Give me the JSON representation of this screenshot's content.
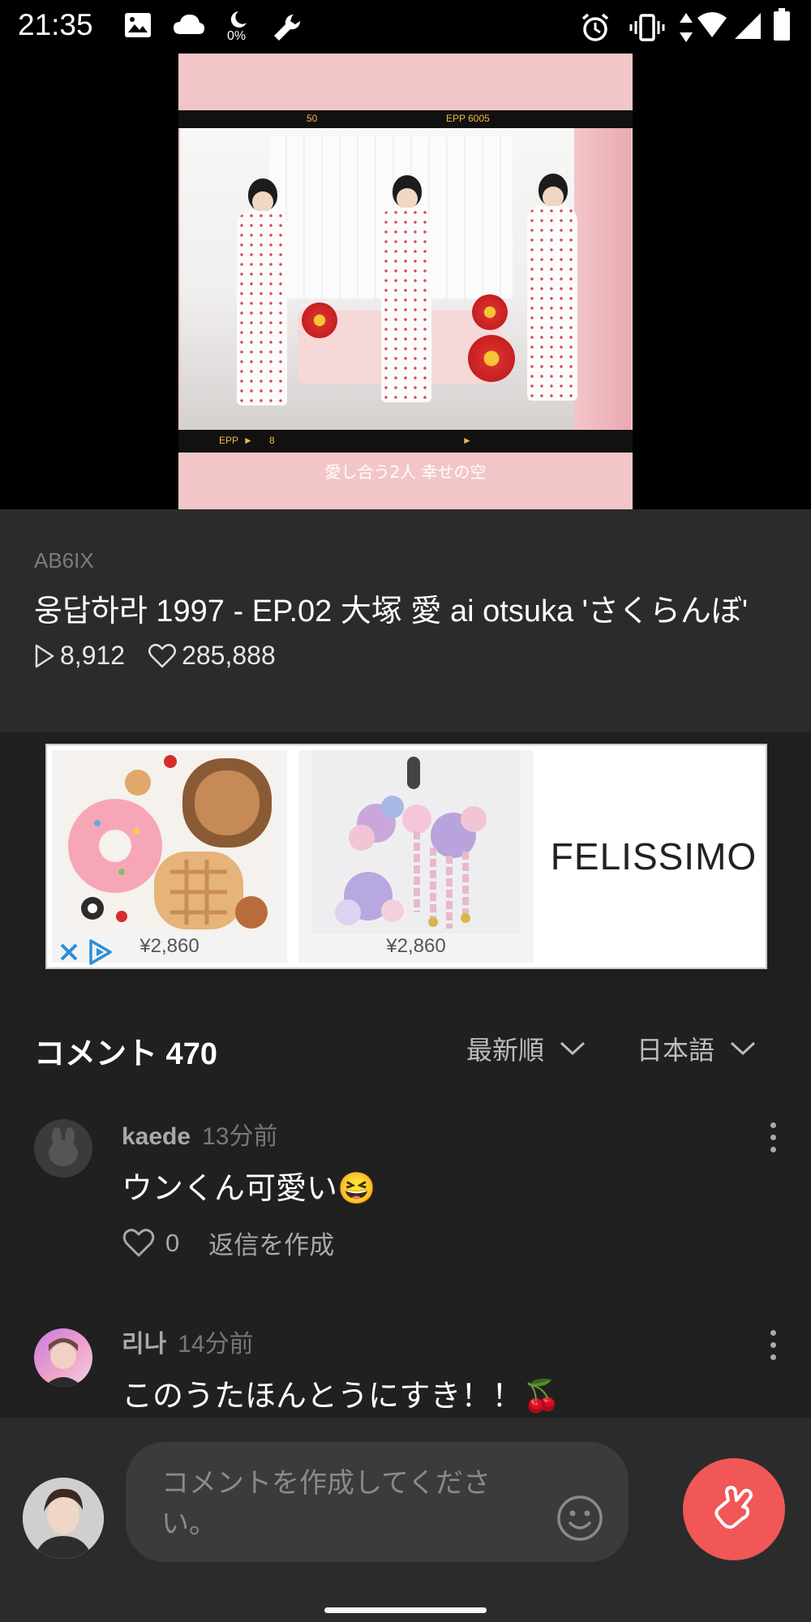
{
  "status_bar": {
    "time": "21:35",
    "notif_icons": [
      "image-icon",
      "cloud-icon",
      "moon-icon",
      "wrench-icon"
    ],
    "moon_percent": "0%",
    "right_icons": [
      "alarm-icon",
      "vibrate-icon",
      "data-arrows-icon",
      "wifi-icon",
      "signal-icon",
      "battery-icon"
    ]
  },
  "video": {
    "poster_top_left": "50",
    "poster_top_right": "EPP 6005",
    "poster_bottom_left": "EPP",
    "poster_bottom_num": "8",
    "poster_caption": "愛し合う2人 幸せの空"
  },
  "info": {
    "artist": "AB6IX",
    "title": "웅답하라 1997 - EP.02 大塚 愛 ai otsuka 'さくらんぼ'",
    "plays": "8,912",
    "likes": "285,888"
  },
  "ad": {
    "items": [
      {
        "price": "¥2,860",
        "image": "sweets-coin-purses"
      },
      {
        "price": "¥2,860",
        "image": "flower-hairpins"
      }
    ],
    "brand": "FELISSIMO",
    "close_icon": "close-icon",
    "adchoices_icon": "adchoices-icon"
  },
  "comments": {
    "header": "コメント 470",
    "sort_label": "最新順",
    "language_label": "日本語",
    "items": [
      {
        "user": "kaede",
        "time": "13分前",
        "text": "ウンくん可愛い😆",
        "likes": "0",
        "reply": "返信を作成"
      },
      {
        "user": "리나",
        "time": "14分前",
        "text": "このうたほんとうにすき！！🍒"
      }
    ]
  },
  "composer": {
    "placeholder": "コメントを作成してください。",
    "emoji_icon": "smiley-icon",
    "send_icon": "finger-heart-icon"
  },
  "colors": {
    "accent": "#f05756",
    "background": "#202020",
    "panel": "#2b2b2b"
  }
}
